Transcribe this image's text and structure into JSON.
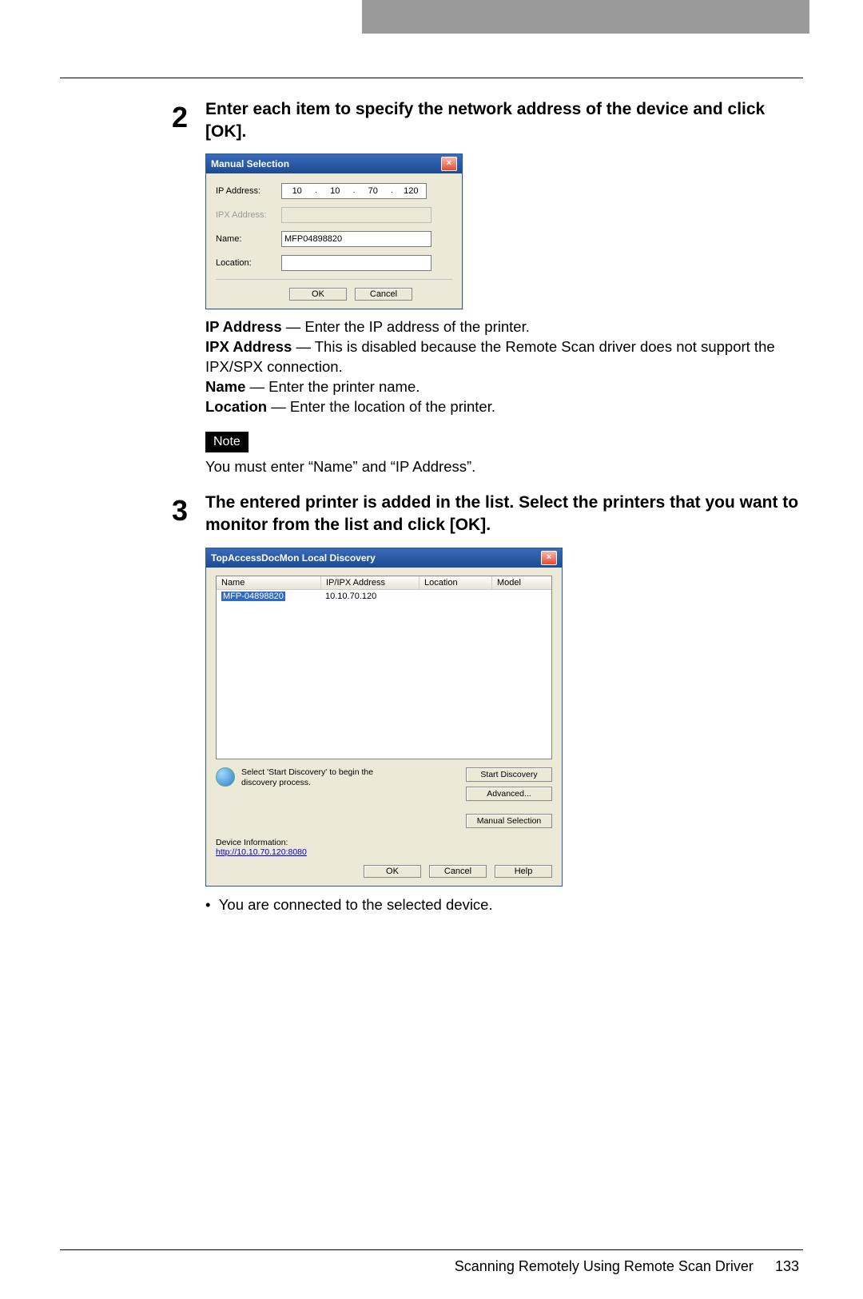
{
  "step2": {
    "num": "2",
    "title": "Enter each item to specify the network address of the device and click [OK].",
    "dialog": {
      "title": "Manual Selection",
      "ip_label": "IP Address:",
      "ip": [
        "10",
        "10",
        "70",
        "120"
      ],
      "ipx_label": "IPX Address:",
      "name_label": "Name:",
      "name_value": "MFP04898820",
      "location_label": "Location:",
      "ok": "OK",
      "cancel": "Cancel"
    },
    "desc": {
      "ip_bold": "IP Address",
      "ip_text": " — Enter the IP address of the printer.",
      "ipx_bold": "IPX Address",
      "ipx_text": " — This is disabled because the Remote Scan driver does not support the IPX/SPX connection.",
      "name_bold": "Name",
      "name_text": " — Enter the printer name.",
      "loc_bold": "Location",
      "loc_text": " — Enter the location of the printer."
    },
    "note_label": "Note",
    "note_text": "You must enter “Name” and “IP Address”."
  },
  "step3": {
    "num": "3",
    "title": "The entered printer is added in the list.  Select the printers that you want to monitor from the list and click [OK].",
    "dialog": {
      "title": "TopAccessDocMon Local Discovery",
      "cols": {
        "name": "Name",
        "ip": "IP/IPX Address",
        "loc": "Location",
        "model": "Model"
      },
      "row": {
        "name": "MFP-04898820",
        "ip": "10.10.70.120"
      },
      "disc_text": "Select 'Start Discovery' to begin the discovery process.",
      "btn_start": "Start Discovery",
      "btn_adv": "Advanced...",
      "btn_manual": "Manual Selection",
      "devinfo_label": "Device Information:",
      "devinfo_link": "http://10.10.70.120:8080",
      "ok": "OK",
      "cancel": "Cancel",
      "help": "Help"
    },
    "bullet": "You are connected to the selected device."
  },
  "footer": {
    "text": "Scanning Remotely Using Remote Scan Driver",
    "page": "133"
  }
}
